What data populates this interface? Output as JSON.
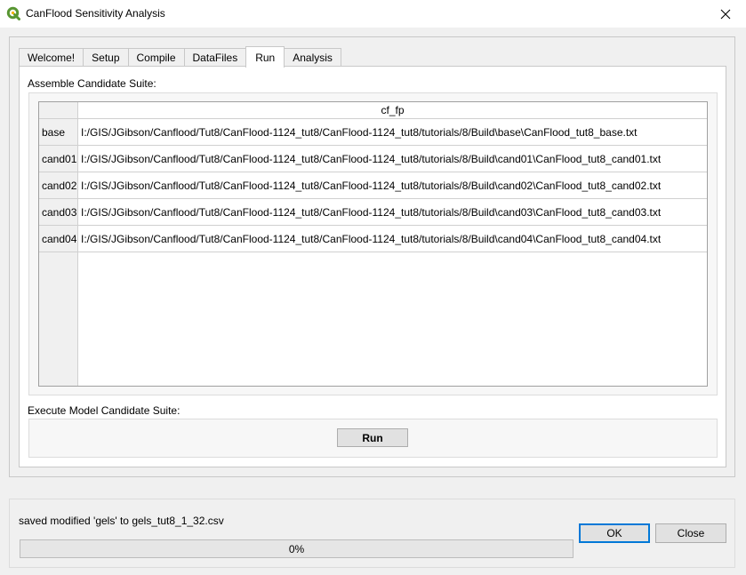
{
  "window": {
    "title": "CanFlood Sensitivity Analysis",
    "accent": "#589632"
  },
  "tabs": [
    {
      "label": "Welcome!"
    },
    {
      "label": "Setup"
    },
    {
      "label": "Compile"
    },
    {
      "label": "DataFiles"
    },
    {
      "label": "Run",
      "active": true
    },
    {
      "label": "Analysis"
    }
  ],
  "run_tab": {
    "assemble_label": "Assemble Candidate Suite:",
    "table": {
      "column_header": "cf_fp",
      "rows": [
        {
          "name": "base",
          "cf_fp": "I:/GIS/JGibson/Canflood/Tut8/CanFlood-1124_tut8/CanFlood-1124_tut8/tutorials/8/Build\\base\\CanFlood_tut8_base.txt"
        },
        {
          "name": "cand01",
          "cf_fp": "I:/GIS/JGibson/Canflood/Tut8/CanFlood-1124_tut8/CanFlood-1124_tut8/tutorials/8/Build\\cand01\\CanFlood_tut8_cand01.txt"
        },
        {
          "name": "cand02",
          "cf_fp": "I:/GIS/JGibson/Canflood/Tut8/CanFlood-1124_tut8/CanFlood-1124_tut8/tutorials/8/Build\\cand02\\CanFlood_tut8_cand02.txt"
        },
        {
          "name": "cand03",
          "cf_fp": "I:/GIS/JGibson/Canflood/Tut8/CanFlood-1124_tut8/CanFlood-1124_tut8/tutorials/8/Build\\cand03\\CanFlood_tut8_cand03.txt"
        },
        {
          "name": "cand04",
          "cf_fp": "I:/GIS/JGibson/Canflood/Tut8/CanFlood-1124_tut8/CanFlood-1124_tut8/tutorials/8/Build\\cand04\\CanFlood_tut8_cand04.txt"
        }
      ]
    },
    "execute_label": "Execute Model Candidate Suite:",
    "run_button": "Run"
  },
  "footer": {
    "status": "saved modified 'gels' to gels_tut8_1_32.csv",
    "progress": {
      "value": 0,
      "text": "0%"
    },
    "ok_button": "OK",
    "close_button": "Close"
  }
}
